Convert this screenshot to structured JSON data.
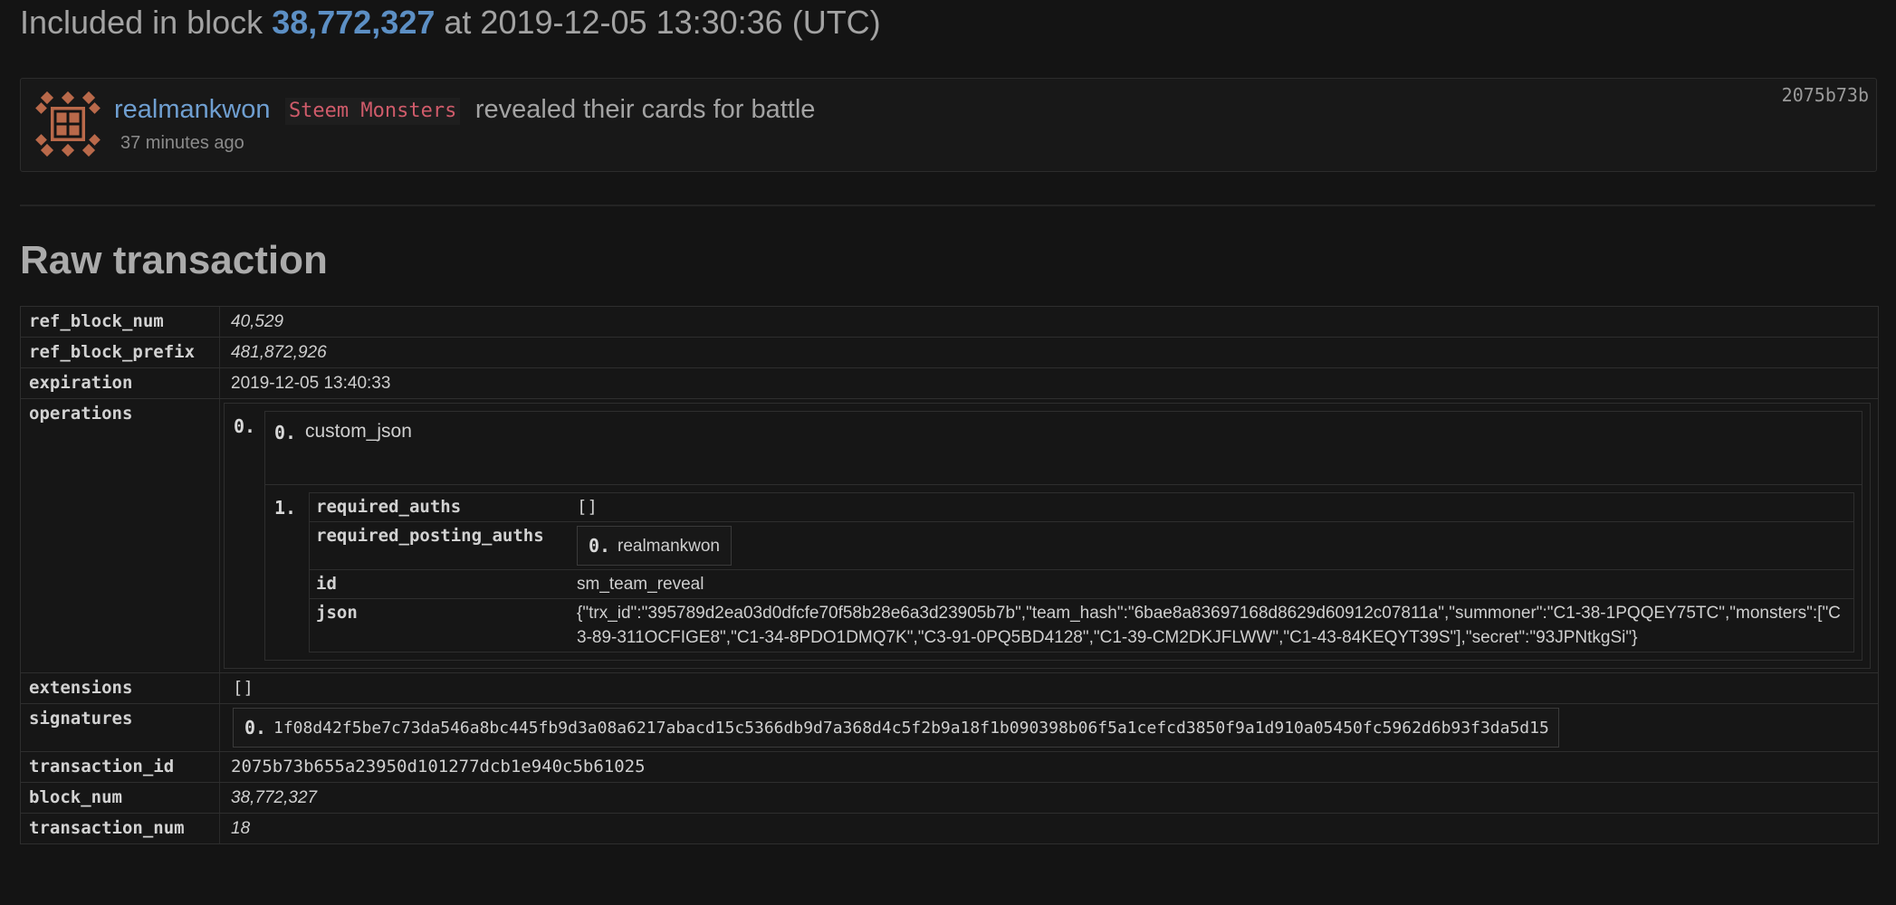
{
  "header": {
    "prefix": "Included in block",
    "block_number": "38,772,327",
    "suffix": "at 2019-12-05 13:30:36 (UTC)"
  },
  "operation_card": {
    "author": "realmankwon",
    "app": "Steem Monsters",
    "description": "revealed their cards for battle",
    "time_ago": "37 minutes ago",
    "trx_short": "2075b73b"
  },
  "section_title": "Raw transaction",
  "raw": {
    "ref_block_num": {
      "key": "ref_block_num",
      "value": "40,529"
    },
    "ref_block_prefix": {
      "key": "ref_block_prefix",
      "value": "481,872,926"
    },
    "expiration": {
      "key": "expiration",
      "value": "2019-12-05 13:40:33"
    },
    "operations": {
      "key": "operations",
      "op_index": "0.",
      "type_index": "0.",
      "type_name": "custom_json",
      "body_index": "1.",
      "fields": {
        "required_auths": {
          "key": "required_auths",
          "value": "[]"
        },
        "required_posting_auths": {
          "key": "required_posting_auths",
          "item_index": "0.",
          "item_value": "realmankwon"
        },
        "id": {
          "key": "id",
          "value": "sm_team_reveal"
        },
        "json": {
          "key": "json",
          "value": "{\"trx_id\":\"395789d2ea03d0dfcfe70f58b28e6a3d23905b7b\",\"team_hash\":\"6bae8a83697168d8629d60912c07811a\",\"summoner\":\"C1-38-1PQQEY75TC\",\"monsters\":[\"C3-89-311OCFIGE8\",\"C1-34-8PDO1DMQ7K\",\"C3-91-0PQ5BD4128\",\"C1-39-CM2DKJFLWW\",\"C1-43-84KEQYT39S\"],\"secret\":\"93JPNtkgSi\"}"
        }
      }
    },
    "extensions": {
      "key": "extensions",
      "value": "[]"
    },
    "signatures": {
      "key": "signatures",
      "item_index": "0.",
      "item_value": "1f08d42f5be7c73da546a8bc445fb9d3a08a6217abacd15c5366db9d7a368d4c5f2b9a18f1b090398b06f5a1cefcd3850f9a1d910a05450fc5962d6b93f3da5d15"
    },
    "transaction_id": {
      "key": "transaction_id",
      "value": "2075b73b655a23950d101277dcb1e940c5b61025"
    },
    "block_num": {
      "key": "block_num",
      "value": "38,772,327"
    },
    "transaction_num": {
      "key": "transaction_num",
      "value": "18"
    }
  },
  "colors": {
    "background": "#141414",
    "link": "#5c8fc4",
    "app_badge": "#cf5b6a",
    "avatar": "#b9694a"
  },
  "icons": {
    "avatar": "identicon-avatar"
  }
}
